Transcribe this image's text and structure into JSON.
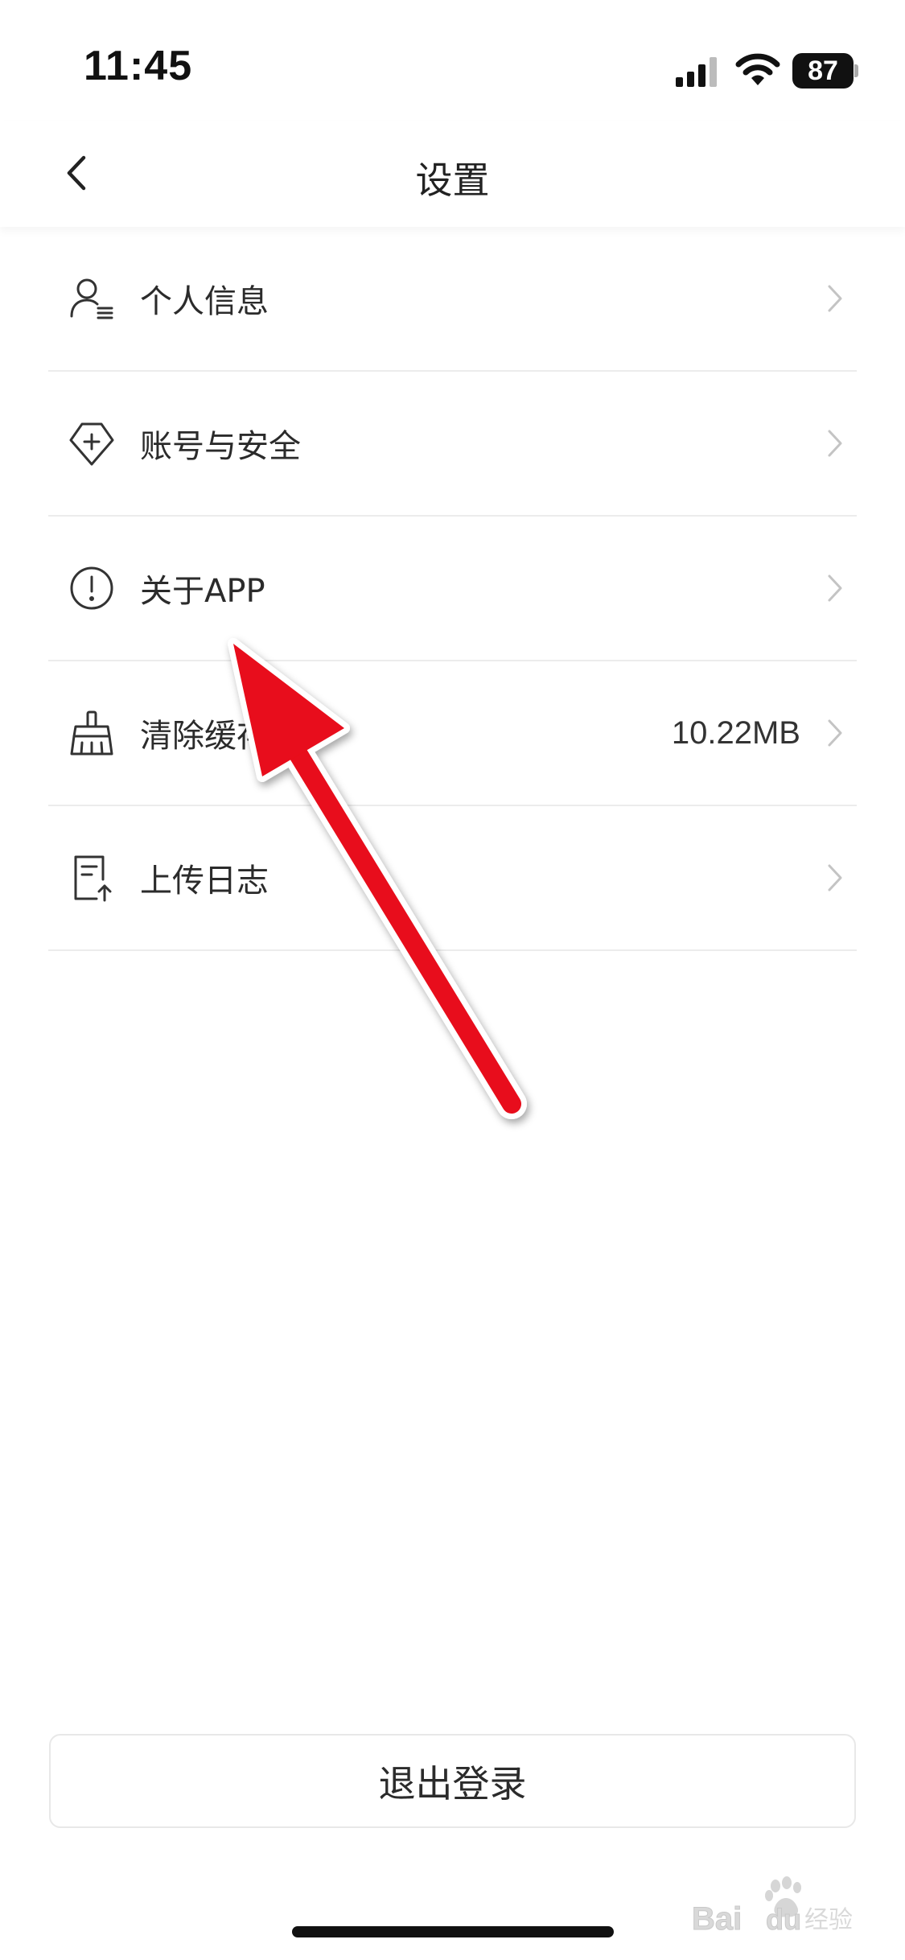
{
  "status_bar": {
    "time": "11:45",
    "battery": "87",
    "icons": [
      "cellular-signal-icon",
      "wifi-icon",
      "battery-icon"
    ]
  },
  "nav": {
    "title": "设置",
    "back_icon": "chevron-left-icon"
  },
  "settings": [
    {
      "label": "个人信息",
      "icon": "user-profile-icon",
      "value": ""
    },
    {
      "label": "账号与安全",
      "icon": "shield-plus-icon",
      "value": ""
    },
    {
      "label": "关于APP",
      "icon": "info-exclamation-icon",
      "value": ""
    },
    {
      "label": "清除缓存",
      "icon": "broom-icon",
      "value": "10.22MB"
    },
    {
      "label": "上传日志",
      "icon": "upload-log-icon",
      "value": ""
    }
  ],
  "logout_label": "退出登录",
  "watermark": "Baidu经验",
  "colors": {
    "annotation_arrow": "#e8101a",
    "divider": "#ececec",
    "chevron": "#c4c4c4"
  }
}
